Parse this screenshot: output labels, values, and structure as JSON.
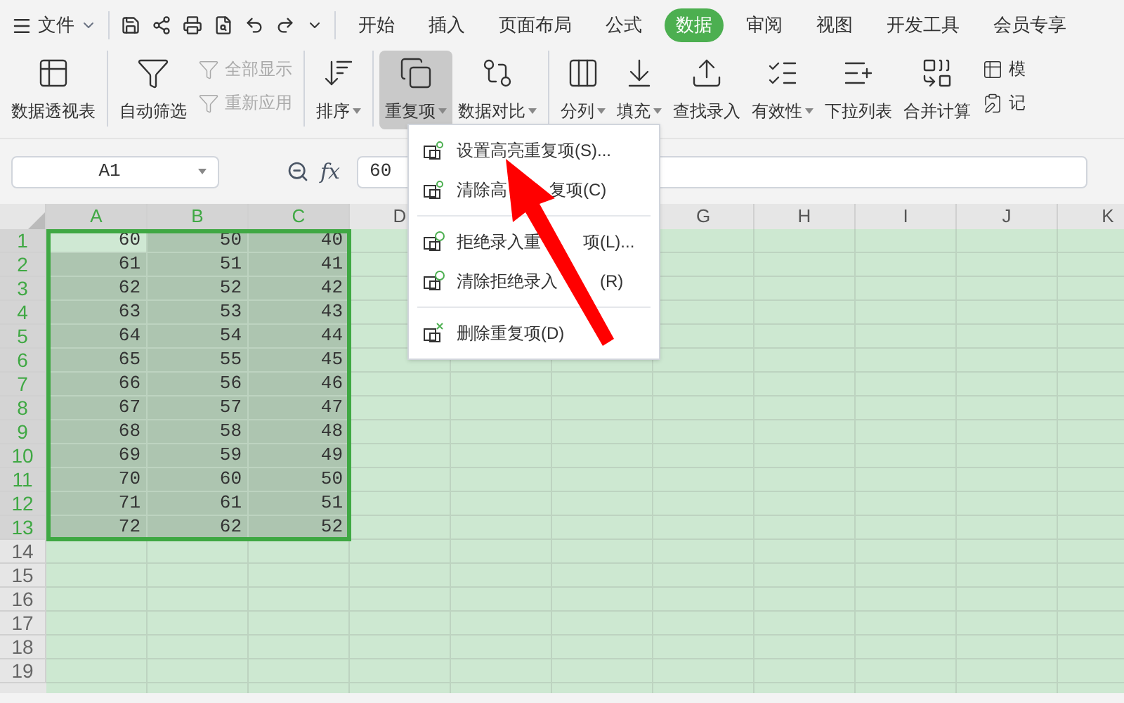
{
  "menu_bar": {
    "file_label": "文件",
    "tabs": [
      {
        "label": "开始",
        "selected": false
      },
      {
        "label": "插入",
        "selected": false
      },
      {
        "label": "页面布局",
        "selected": false
      },
      {
        "label": "公式",
        "selected": false
      },
      {
        "label": "数据",
        "selected": true
      },
      {
        "label": "审阅",
        "selected": false
      },
      {
        "label": "视图",
        "selected": false
      },
      {
        "label": "开发工具",
        "selected": false
      },
      {
        "label": "会员专享",
        "selected": false
      }
    ]
  },
  "ribbon": [
    {
      "kind": "big",
      "label": "数据透视表",
      "dropdown": false,
      "selected": false
    },
    {
      "kind": "big",
      "label": "自动筛选",
      "dropdown": false,
      "selected": false
    },
    {
      "kind": "small",
      "items": [
        {
          "label": "全部显示",
          "disabled": true
        },
        {
          "label": "重新应用",
          "disabled": true
        }
      ]
    },
    {
      "kind": "big",
      "label": "排序",
      "dropdown": true,
      "selected": false
    },
    {
      "kind": "big",
      "label": "重复项",
      "dropdown": true,
      "selected": true
    },
    {
      "kind": "big",
      "label": "数据对比",
      "dropdown": true,
      "selected": false
    },
    {
      "kind": "big",
      "label": "分列",
      "dropdown": true,
      "selected": false
    },
    {
      "kind": "big",
      "label": "填充",
      "dropdown": true,
      "selected": false
    },
    {
      "kind": "big",
      "label": "查找录入",
      "dropdown": false,
      "selected": false
    },
    {
      "kind": "big",
      "label": "有效性",
      "dropdown": true,
      "selected": false
    },
    {
      "kind": "big",
      "label": "下拉列表",
      "dropdown": false,
      "selected": false
    },
    {
      "kind": "big",
      "label": "合并计算",
      "dropdown": false,
      "selected": false
    },
    {
      "kind": "small",
      "items": [
        {
          "label": "模",
          "disabled": false
        },
        {
          "label": "记",
          "disabled": false
        }
      ]
    }
  ],
  "formula_bar": {
    "name_box": "A1",
    "fx_label": "fx",
    "value": "60"
  },
  "dropdown_menu": [
    {
      "parts": [
        "设置高亮重复项(S)..."
      ]
    },
    {
      "parts": [
        "清除高",
        "复项(C)"
      ]
    },
    {
      "parts": [
        "拒绝录入重",
        "项(L)..."
      ]
    },
    {
      "parts": [
        "清除拒绝录入",
        "(R)"
      ]
    },
    {
      "parts": [
        "删除重复项(D)"
      ]
    }
  ],
  "sheet": {
    "columns": [
      {
        "label": "A",
        "selected": true
      },
      {
        "label": "B",
        "selected": true
      },
      {
        "label": "C",
        "selected": true
      },
      {
        "label": "D",
        "selected": false
      },
      {
        "label": "G",
        "selected": false
      },
      {
        "label": "H",
        "selected": false
      },
      {
        "label": "I",
        "selected": false
      },
      {
        "label": "J",
        "selected": false
      },
      {
        "label": "K",
        "selected": false
      }
    ],
    "rows": [
      {
        "num": "1",
        "selected": true,
        "cells": [
          "60",
          "50",
          "40"
        ]
      },
      {
        "num": "2",
        "selected": true,
        "cells": [
          "61",
          "51",
          "41"
        ]
      },
      {
        "num": "3",
        "selected": true,
        "cells": [
          "62",
          "52",
          "42"
        ]
      },
      {
        "num": "4",
        "selected": true,
        "cells": [
          "63",
          "53",
          "43"
        ]
      },
      {
        "num": "5",
        "selected": true,
        "cells": [
          "64",
          "54",
          "44"
        ]
      },
      {
        "num": "6",
        "selected": true,
        "cells": [
          "65",
          "55",
          "45"
        ]
      },
      {
        "num": "7",
        "selected": true,
        "cells": [
          "66",
          "56",
          "46"
        ]
      },
      {
        "num": "8",
        "selected": true,
        "cells": [
          "67",
          "57",
          "47"
        ]
      },
      {
        "num": "9",
        "selected": true,
        "cells": [
          "68",
          "58",
          "48"
        ]
      },
      {
        "num": "10",
        "selected": true,
        "cells": [
          "69",
          "59",
          "49"
        ]
      },
      {
        "num": "11",
        "selected": true,
        "cells": [
          "70",
          "60",
          "50"
        ]
      },
      {
        "num": "12",
        "selected": true,
        "cells": [
          "71",
          "61",
          "51"
        ]
      },
      {
        "num": "13",
        "selected": true,
        "cells": [
          "72",
          "62",
          "52"
        ]
      },
      {
        "num": "14",
        "selected": false,
        "cells": []
      },
      {
        "num": "15",
        "selected": false,
        "cells": []
      },
      {
        "num": "16",
        "selected": false,
        "cells": []
      },
      {
        "num": "17",
        "selected": false,
        "cells": []
      },
      {
        "num": "18",
        "selected": false,
        "cells": []
      },
      {
        "num": "19",
        "selected": false,
        "cells": []
      }
    ]
  }
}
